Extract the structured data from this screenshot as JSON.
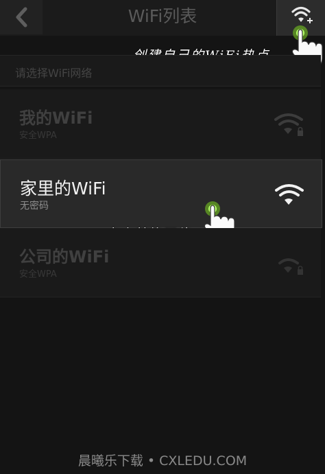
{
  "header": {
    "title": "WiFi列表"
  },
  "list": {
    "prompt": "请选择WiFi网络",
    "networks": [
      {
        "name": "我的WiFi",
        "security": "安全WPA"
      },
      {
        "name": "家里的WiFi",
        "security": "无密码",
        "selected": true
      },
      {
        "name": "公司的WiFi",
        "security": "安全WPA"
      }
    ]
  },
  "annotations": {
    "hotspot": "创建自己的WiFi热点",
    "switch": "点击替换网络"
  },
  "footer": {
    "watermark": "晨曦乐下载 • CXLEDU.COM"
  },
  "colors": {
    "background": "#141414",
    "selected_card": "#292929",
    "tap_indicator": "#7ed321"
  },
  "icons": [
    "back-icon",
    "wifi-add-icon",
    "wifi-signal-icon",
    "lock-icon",
    "tap-hand-icon"
  ]
}
